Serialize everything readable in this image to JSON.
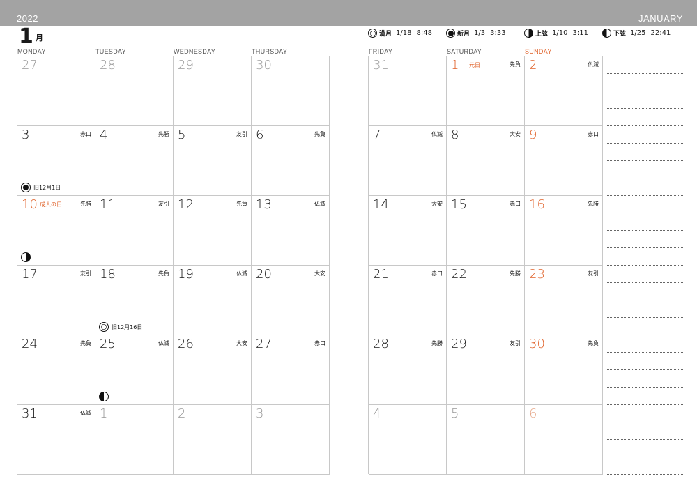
{
  "header": {
    "year": "2022",
    "month_en": "JANUARY"
  },
  "month": {
    "number": "1",
    "kanji": "月"
  },
  "moon_phases": [
    {
      "icon": "full-moon-icon",
      "phase": "full",
      "name": "満月",
      "date": "1/18",
      "time": "8:48"
    },
    {
      "icon": "new-moon-icon",
      "phase": "new",
      "name": "新月",
      "date": "1/3",
      "time": "3:33"
    },
    {
      "icon": "first-quarter-moon-icon",
      "phase": "first",
      "name": "上弦",
      "date": "1/10",
      "time": "3:11"
    },
    {
      "icon": "last-quarter-moon-icon",
      "phase": "last",
      "name": "下弦",
      "date": "1/25",
      "time": "22:41"
    }
  ],
  "weekdays_left": [
    "MONDAY",
    "TUESDAY",
    "WEDNESDAY",
    "THURSDAY"
  ],
  "weekdays_right": [
    "FRIDAY",
    "SATURDAY",
    "SUNDAY"
  ],
  "weeks": [
    [
      {
        "day": "27",
        "dim": true
      },
      {
        "day": "28",
        "dim": true
      },
      {
        "day": "29",
        "dim": true
      },
      {
        "day": "30",
        "dim": true
      },
      {
        "day": "31",
        "dim": true
      },
      {
        "day": "1",
        "red": true,
        "holiday": "元日",
        "rokuyo": "先負"
      },
      {
        "day": "2",
        "red": true,
        "rokuyo": "仏滅"
      }
    ],
    [
      {
        "day": "3",
        "rokuyo": "赤口",
        "note": {
          "moon": "new",
          "text": "旧12月1日"
        }
      },
      {
        "day": "4",
        "rokuyo": "先勝"
      },
      {
        "day": "5",
        "rokuyo": "友引"
      },
      {
        "day": "6",
        "rokuyo": "先負"
      },
      {
        "day": "7",
        "rokuyo": "仏滅"
      },
      {
        "day": "8",
        "rokuyo": "大安"
      },
      {
        "day": "9",
        "red": true,
        "rokuyo": "赤口"
      }
    ],
    [
      {
        "day": "10",
        "red": true,
        "holiday": "成人の日",
        "rokuyo": "先勝",
        "note": {
          "moon": "first",
          "text": ""
        }
      },
      {
        "day": "11",
        "rokuyo": "友引"
      },
      {
        "day": "12",
        "rokuyo": "先負"
      },
      {
        "day": "13",
        "rokuyo": "仏滅"
      },
      {
        "day": "14",
        "rokuyo": "大安"
      },
      {
        "day": "15",
        "rokuyo": "赤口"
      },
      {
        "day": "16",
        "red": true,
        "rokuyo": "先勝"
      }
    ],
    [
      {
        "day": "17",
        "rokuyo": "友引"
      },
      {
        "day": "18",
        "rokuyo": "先負",
        "note": {
          "moon": "full",
          "text": "旧12月16日"
        }
      },
      {
        "day": "19",
        "rokuyo": "仏滅"
      },
      {
        "day": "20",
        "rokuyo": "大安"
      },
      {
        "day": "21",
        "rokuyo": "赤口"
      },
      {
        "day": "22",
        "rokuyo": "先勝"
      },
      {
        "day": "23",
        "red": true,
        "rokuyo": "友引"
      }
    ],
    [
      {
        "day": "24",
        "rokuyo": "先負"
      },
      {
        "day": "25",
        "rokuyo": "仏滅",
        "note": {
          "moon": "last",
          "text": ""
        }
      },
      {
        "day": "26",
        "rokuyo": "大安"
      },
      {
        "day": "27",
        "rokuyo": "赤口"
      },
      {
        "day": "28",
        "rokuyo": "先勝"
      },
      {
        "day": "29",
        "rokuyo": "友引"
      },
      {
        "day": "30",
        "red": true,
        "rokuyo": "先負"
      }
    ],
    [
      {
        "day": "31",
        "rokuyo": "仏滅"
      },
      {
        "day": "1",
        "dim": true
      },
      {
        "day": "2",
        "dim": true
      },
      {
        "day": "3",
        "dim": true
      },
      {
        "day": "4",
        "dim": true
      },
      {
        "day": "5",
        "dim": true
      },
      {
        "day": "6",
        "dimred": true
      }
    ]
  ],
  "colors": {
    "header_bar": "#a3a3a3",
    "sunday": "#e0622a",
    "grid": "#c8c8c8"
  }
}
